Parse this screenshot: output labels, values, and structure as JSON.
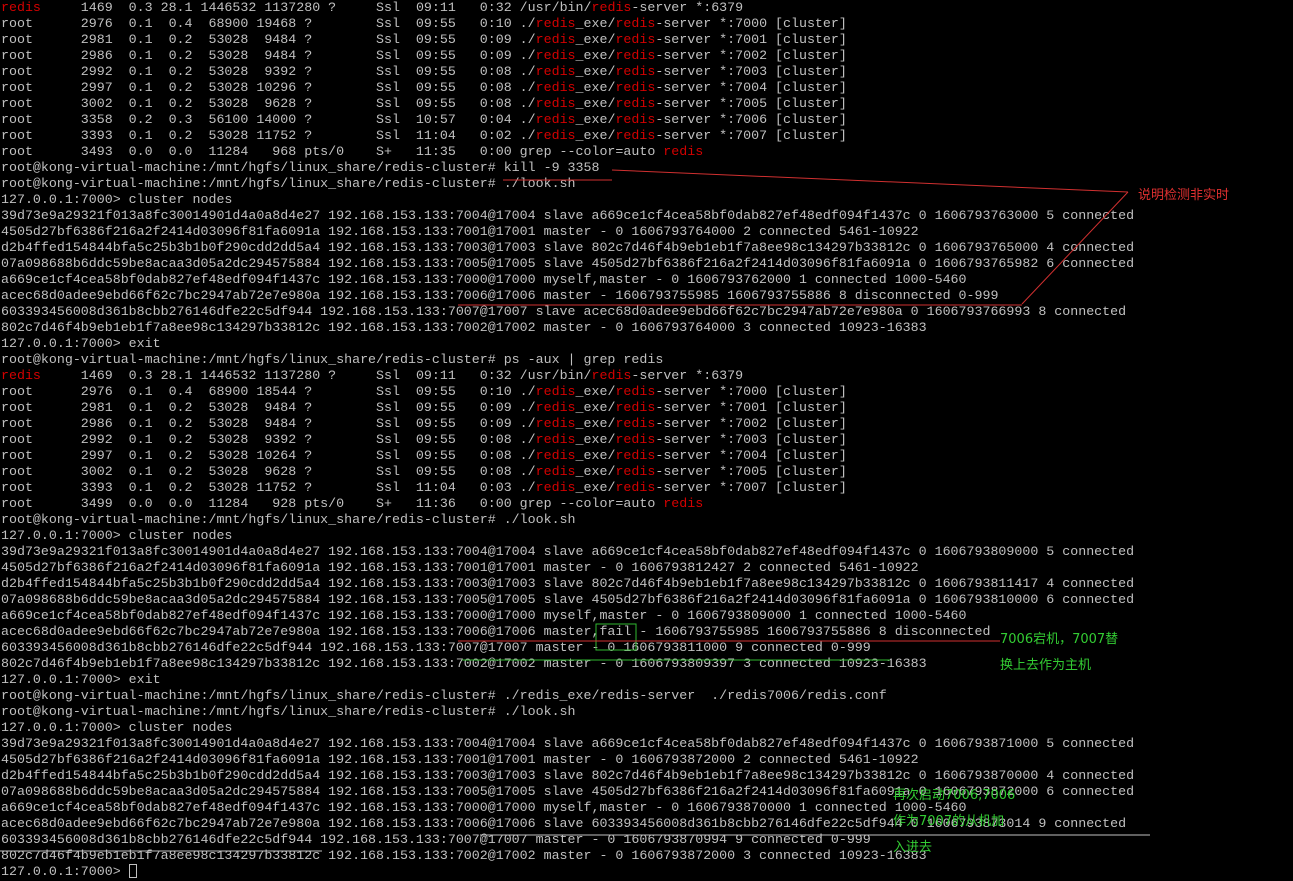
{
  "terminal": {
    "lines": [
      [
        {
          "t": "redis",
          "c": "hl"
        },
        {
          "t": "     1469  0.3 28.1 1446532 1137280 ?     Ssl  09:11   0:32 /usr/bin/"
        },
        {
          "t": "redis",
          "c": "hl"
        },
        {
          "t": "-server *:6379"
        }
      ],
      [
        {
          "t": "root      2976  0.1  0.4  68900 19468 ?        Ssl  09:55   0:10 ./"
        },
        {
          "t": "redis",
          "c": "hl"
        },
        {
          "t": "_exe/"
        },
        {
          "t": "redis",
          "c": "hl"
        },
        {
          "t": "-server *:7000 [cluster]"
        }
      ],
      [
        {
          "t": "root      2981  0.1  0.2  53028  9484 ?        Ssl  09:55   0:09 ./"
        },
        {
          "t": "redis",
          "c": "hl"
        },
        {
          "t": "_exe/"
        },
        {
          "t": "redis",
          "c": "hl"
        },
        {
          "t": "-server *:7001 [cluster]"
        }
      ],
      [
        {
          "t": "root      2986  0.1  0.2  53028  9484 ?        Ssl  09:55   0:09 ./"
        },
        {
          "t": "redis",
          "c": "hl"
        },
        {
          "t": "_exe/"
        },
        {
          "t": "redis",
          "c": "hl"
        },
        {
          "t": "-server *:7002 [cluster]"
        }
      ],
      [
        {
          "t": "root      2992  0.1  0.2  53028  9392 ?        Ssl  09:55   0:08 ./"
        },
        {
          "t": "redis",
          "c": "hl"
        },
        {
          "t": "_exe/"
        },
        {
          "t": "redis",
          "c": "hl"
        },
        {
          "t": "-server *:7003 [cluster]"
        }
      ],
      [
        {
          "t": "root      2997  0.1  0.2  53028 10296 ?        Ssl  09:55   0:08 ./"
        },
        {
          "t": "redis",
          "c": "hl"
        },
        {
          "t": "_exe/"
        },
        {
          "t": "redis",
          "c": "hl"
        },
        {
          "t": "-server *:7004 [cluster]"
        }
      ],
      [
        {
          "t": "root      3002  0.1  0.2  53028  9628 ?        Ssl  09:55   0:08 ./"
        },
        {
          "t": "redis",
          "c": "hl"
        },
        {
          "t": "_exe/"
        },
        {
          "t": "redis",
          "c": "hl"
        },
        {
          "t": "-server *:7005 [cluster]"
        }
      ],
      [
        {
          "t": "root      3358  0.2  0.3  56100 14000 ?        Ssl  10:57   0:04 ./"
        },
        {
          "t": "redis",
          "c": "hl"
        },
        {
          "t": "_exe/"
        },
        {
          "t": "redis",
          "c": "hl"
        },
        {
          "t": "-server *:7006 [cluster]"
        }
      ],
      [
        {
          "t": "root      3393  0.1  0.2  53028 11752 ?        Ssl  11:04   0:02 ./"
        },
        {
          "t": "redis",
          "c": "hl"
        },
        {
          "t": "_exe/"
        },
        {
          "t": "redis",
          "c": "hl"
        },
        {
          "t": "-server *:7007 [cluster]"
        }
      ],
      [
        {
          "t": "root      3493  0.0  0.0  11284   968 pts/0    S+   11:35   0:00 grep --color=auto "
        },
        {
          "t": "redis",
          "c": "hl"
        }
      ],
      [
        {
          "t": "root@kong-virtual-machine:/mnt/hgfs/linux_share/redis-cluster# kill -9 3358"
        }
      ],
      [
        {
          "t": "root@kong-virtual-machine:/mnt/hgfs/linux_share/redis-cluster# ./look.sh"
        }
      ],
      [
        {
          "t": "127.0.0.1:7000> cluster nodes"
        }
      ],
      [
        {
          "t": "39d73e9a29321f013a8fc30014901d4a0a8d4e27 192.168.153.133:7004@17004 slave a669ce1cf4cea58bf0dab827ef48edf094f1437c 0 1606793763000 5 connected"
        }
      ],
      [
        {
          "t": "4505d27bf6386f216a2f2414d03096f81fa6091a 192.168.153.133:7001@17001 master - 0 1606793764000 2 connected 5461-10922"
        }
      ],
      [
        {
          "t": "d2b4ffed154844bfa5c25b3b1b0f290cdd2dd5a4 192.168.153.133:7003@17003 slave 802c7d46f4b9eb1eb1f7a8ee98c134297b33812c 0 1606793765000 4 connected"
        }
      ],
      [
        {
          "t": "07a098688b6ddc59be8acaa3d05a2dc294575884 192.168.153.133:7005@17005 slave 4505d27bf6386f216a2f2414d03096f81fa6091a 0 1606793765982 6 connected"
        }
      ],
      [
        {
          "t": "a669ce1cf4cea58bf0dab827ef48edf094f1437c 192.168.153.133:7000@17000 myself,master - 0 1606793762000 1 connected 1000-5460"
        }
      ],
      [
        {
          "t": "acec68d0adee9ebd66f62c7bc2947ab72e7e980a 192.168.153.133:7006@17006 master - 1606793755985 1606793755886 8 disconnected 0-999"
        }
      ],
      [
        {
          "t": "603393456008d361b8cbb276146dfe22c5df944 192.168.153.133:7007@17007 slave acec68d0adee9ebd66f62c7bc2947ab72e7e980a 0 1606793766993 8 connected"
        }
      ],
      [
        {
          "t": "802c7d46f4b9eb1eb1f7a8ee98c134297b33812c 192.168.153.133:7002@17002 master - 0 1606793764000 3 connected 10923-16383"
        }
      ],
      [
        {
          "t": "127.0.0.1:7000> exit"
        }
      ],
      [
        {
          "t": "root@kong-virtual-machine:/mnt/hgfs/linux_share/redis-cluster# ps -aux | grep redis"
        }
      ],
      [
        {
          "t": "redis",
          "c": "hl"
        },
        {
          "t": "     1469  0.3 28.1 1446532 1137280 ?     Ssl  09:11   0:32 /usr/bin/"
        },
        {
          "t": "redis",
          "c": "hl"
        },
        {
          "t": "-server *:6379"
        }
      ],
      [
        {
          "t": "root      2976  0.1  0.4  68900 18544 ?        Ssl  09:55   0:10 ./"
        },
        {
          "t": "redis",
          "c": "hl"
        },
        {
          "t": "_exe/"
        },
        {
          "t": "redis",
          "c": "hl"
        },
        {
          "t": "-server *:7000 [cluster]"
        }
      ],
      [
        {
          "t": "root      2981  0.1  0.2  53028  9484 ?        Ssl  09:55   0:09 ./"
        },
        {
          "t": "redis",
          "c": "hl"
        },
        {
          "t": "_exe/"
        },
        {
          "t": "redis",
          "c": "hl"
        },
        {
          "t": "-server *:7001 [cluster]"
        }
      ],
      [
        {
          "t": "root      2986  0.1  0.2  53028  9484 ?        Ssl  09:55   0:09 ./"
        },
        {
          "t": "redis",
          "c": "hl"
        },
        {
          "t": "_exe/"
        },
        {
          "t": "redis",
          "c": "hl"
        },
        {
          "t": "-server *:7002 [cluster]"
        }
      ],
      [
        {
          "t": "root      2992  0.1  0.2  53028  9392 ?        Ssl  09:55   0:08 ./"
        },
        {
          "t": "redis",
          "c": "hl"
        },
        {
          "t": "_exe/"
        },
        {
          "t": "redis",
          "c": "hl"
        },
        {
          "t": "-server *:7003 [cluster]"
        }
      ],
      [
        {
          "t": "root      2997  0.1  0.2  53028 10264 ?        Ssl  09:55   0:08 ./"
        },
        {
          "t": "redis",
          "c": "hl"
        },
        {
          "t": "_exe/"
        },
        {
          "t": "redis",
          "c": "hl"
        },
        {
          "t": "-server *:7004 [cluster]"
        }
      ],
      [
        {
          "t": "root      3002  0.1  0.2  53028  9628 ?        Ssl  09:55   0:08 ./"
        },
        {
          "t": "redis",
          "c": "hl"
        },
        {
          "t": "_exe/"
        },
        {
          "t": "redis",
          "c": "hl"
        },
        {
          "t": "-server *:7005 [cluster]"
        }
      ],
      [
        {
          "t": "root      3393  0.1  0.2  53028 11752 ?        Ssl  11:04   0:03 ./"
        },
        {
          "t": "redis",
          "c": "hl"
        },
        {
          "t": "_exe/"
        },
        {
          "t": "redis",
          "c": "hl"
        },
        {
          "t": "-server *:7007 [cluster]"
        }
      ],
      [
        {
          "t": "root      3499  0.0  0.0  11284   928 pts/0    S+   11:36   0:00 grep --color=auto "
        },
        {
          "t": "redis",
          "c": "hl"
        }
      ],
      [
        {
          "t": "root@kong-virtual-machine:/mnt/hgfs/linux_share/redis-cluster# ./look.sh"
        }
      ],
      [
        {
          "t": "127.0.0.1:7000> cluster nodes"
        }
      ],
      [
        {
          "t": "39d73e9a29321f013a8fc30014901d4a0a8d4e27 192.168.153.133:7004@17004 slave a669ce1cf4cea58bf0dab827ef48edf094f1437c 0 1606793809000 5 connected"
        }
      ],
      [
        {
          "t": "4505d27bf6386f216a2f2414d03096f81fa6091a 192.168.153.133:7001@17001 master - 0 1606793812427 2 connected 5461-10922"
        }
      ],
      [
        {
          "t": "d2b4ffed154844bfa5c25b3b1b0f290cdd2dd5a4 192.168.153.133:7003@17003 slave 802c7d46f4b9eb1eb1f7a8ee98c134297b33812c 0 1606793811417 4 connected"
        }
      ],
      [
        {
          "t": "07a098688b6ddc59be8acaa3d05a2dc294575884 192.168.153.133:7005@17005 slave 4505d27bf6386f216a2f2414d03096f81fa6091a 0 1606793810000 6 connected"
        }
      ],
      [
        {
          "t": "a669ce1cf4cea58bf0dab827ef48edf094f1437c 192.168.153.133:7000@17000 myself,master - 0 1606793809000 1 connected 1000-5460"
        }
      ],
      [
        {
          "t": "acec68d0adee9ebd66f62c7bc2947ab72e7e980a 192.168.153.133:7006@17006 master,fail - 1606793755985 1606793755886 8 disconnected"
        }
      ],
      [
        {
          "t": "603393456008d361b8cbb276146dfe22c5df944 192.168.153.133:7007@17007 master - 0 1606793811000 9 connected 0-999"
        }
      ],
      [
        {
          "t": "802c7d46f4b9eb1eb1f7a8ee98c134297b33812c 192.168.153.133:7002@17002 master - 0 1606793809397 3 connected 10923-16383"
        }
      ],
      [
        {
          "t": "127.0.0.1:7000> exit"
        }
      ],
      [
        {
          "t": "root@kong-virtual-machine:/mnt/hgfs/linux_share/redis-cluster# ./redis_exe/redis-server  ./redis7006/redis.conf"
        }
      ],
      [
        {
          "t": "root@kong-virtual-machine:/mnt/hgfs/linux_share/redis-cluster# ./look.sh"
        }
      ],
      [
        {
          "t": "127.0.0.1:7000> cluster nodes"
        }
      ],
      [
        {
          "t": "39d73e9a29321f013a8fc30014901d4a0a8d4e27 192.168.153.133:7004@17004 slave a669ce1cf4cea58bf0dab827ef48edf094f1437c 0 1606793871000 5 connected"
        }
      ],
      [
        {
          "t": "4505d27bf6386f216a2f2414d03096f81fa6091a 192.168.153.133:7001@17001 master - 0 1606793872000 2 connected 5461-10922"
        }
      ],
      [
        {
          "t": "d2b4ffed154844bfa5c25b3b1b0f290cdd2dd5a4 192.168.153.133:7003@17003 slave 802c7d46f4b9eb1eb1f7a8ee98c134297b33812c 0 1606793870000 4 connected"
        }
      ],
      [
        {
          "t": "07a098688b6ddc59be8acaa3d05a2dc294575884 192.168.153.133:7005@17005 slave 4505d27bf6386f216a2f2414d03096f81fa6091a 0 1606793872000 6 connected"
        }
      ],
      [
        {
          "t": "a669ce1cf4cea58bf0dab827ef48edf094f1437c 192.168.153.133:7000@17000 myself,master - 0 1606793870000 1 connected 1000-5460"
        }
      ],
      [
        {
          "t": "acec68d0adee9ebd66f62c7bc2947ab72e7e980a 192.168.153.133:7006@17006 slave 603393456008d361b8cbb276146dfe22c5df944 0 1606793873014 9 connected"
        }
      ],
      [
        {
          "t": "603393456008d361b8cbb276146dfe22c5df944 192.168.153.133:7007@17007 master - 0 1606793870994 9 connected 0-999"
        }
      ],
      [
        {
          "t": "802c7d46f4b9eb1eb1f7a8ee98c134297b33812c 192.168.153.133:7002@17002 master - 0 1606793872000 3 connected 10923-16383"
        }
      ],
      [
        {
          "t": "127.0.0.1:7000> "
        }
      ]
    ]
  },
  "annotations": {
    "note1": "说明检测非实时",
    "note2_line1": "7006宕机，7007替",
    "note2_line2": "换上去作为主机",
    "note3_line1": "再次启动7006,7006",
    "note3_line2": "作为7007的从机加",
    "note3_line3": "入进去"
  },
  "colors": {
    "background": "#000000",
    "text": "#c0c0c0",
    "highlight": "#d40000",
    "annotation_red": "#e03030",
    "annotation_green": "#33cc33"
  }
}
